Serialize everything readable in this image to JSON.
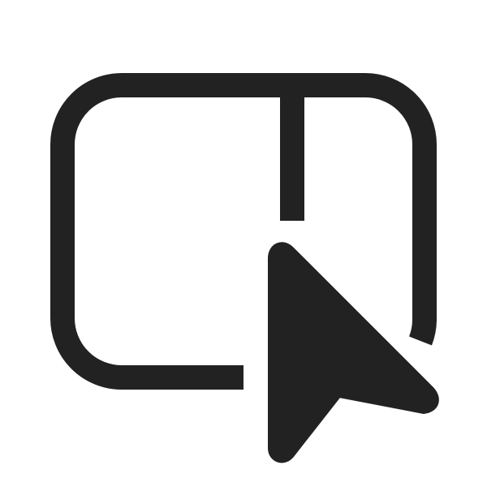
{
  "icon": {
    "name": "window-pointer-icon",
    "description_semantic": "window-panel-with-cursor",
    "stroke_color": "#222222",
    "fill_color": "#222222",
    "background_color": "#ffffff"
  }
}
